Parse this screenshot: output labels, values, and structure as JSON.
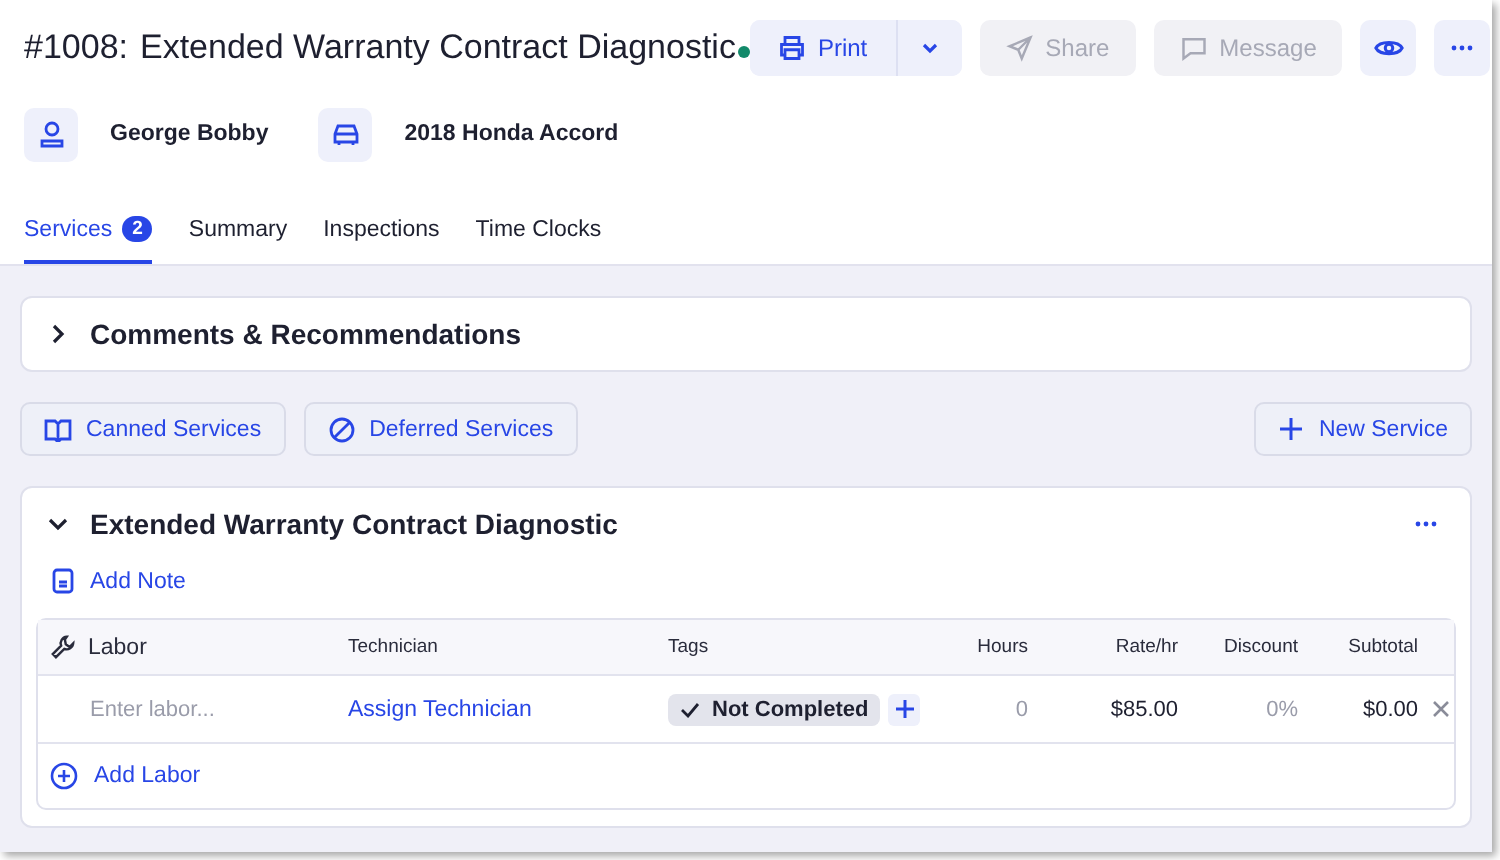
{
  "header": {
    "number": "#1008:",
    "title": "Extended Warranty Contract Diagnostic",
    "status_dot": true
  },
  "actions": [
    {
      "kind": "print",
      "label": "Print",
      "disabled": false
    },
    {
      "kind": "share",
      "label": "Share",
      "disabled": true
    },
    {
      "kind": "message",
      "label": "Message",
      "disabled": true
    }
  ],
  "customer": "George Bobby",
  "vehicle": "2018 Honda Accord",
  "tabs": [
    {
      "label": "Services",
      "badge": "2",
      "selected": true
    },
    {
      "label": "Summary",
      "selected": false
    },
    {
      "label": "Inspections",
      "selected": false
    },
    {
      "label": "Time Clocks",
      "selected": false
    }
  ],
  "comments": {
    "title": "Comments & Recommendations",
    "expanded": false
  },
  "toolbar": {
    "canned": "Canned Services",
    "deferred": "Deferred Services",
    "new_service": "New Service"
  },
  "service": {
    "title": "Extended Warranty Contract Diagnostic",
    "expanded": true,
    "add_note": "Add Note",
    "columns": [
      "Labor",
      "Technician",
      "Tags",
      "Hours",
      "Rate/hr",
      "Discount",
      "Subtotal"
    ],
    "rows": [
      {
        "labor_placeholder": "Enter labor...",
        "technician": "Assign Technician",
        "tag": "Not Completed",
        "hours": "0",
        "rate": "$85.00",
        "discount": "0%",
        "subtotal": "$0.00"
      }
    ],
    "add_labor": "Add Labor"
  }
}
